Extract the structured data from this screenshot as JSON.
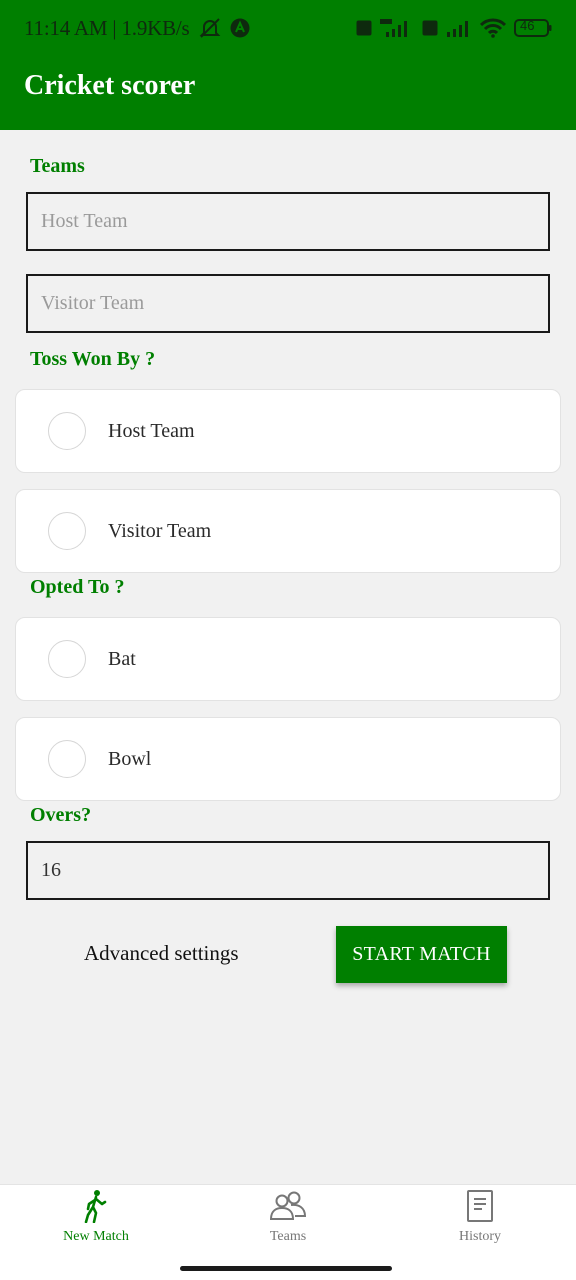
{
  "status_bar": {
    "time_speed": "11:14 AM | 1.9KB/s",
    "battery": "46"
  },
  "app_bar": {
    "title": "Cricket scorer"
  },
  "teams_section": {
    "label": "Teams",
    "host_placeholder": "Host Team",
    "visitor_placeholder": "Visitor Team"
  },
  "toss_section": {
    "label": "Toss Won By ?",
    "options": [
      "Host Team",
      "Visitor Team"
    ]
  },
  "opted_section": {
    "label": "Opted To ?",
    "options": [
      "Bat",
      "Bowl"
    ]
  },
  "overs_section": {
    "label": "Overs?",
    "value": "16"
  },
  "actions": {
    "advanced_label": "Advanced settings",
    "start_label": "START MATCH"
  },
  "bottom_nav": {
    "items": [
      {
        "label": "New Match",
        "icon": "walking-person-icon",
        "active": true
      },
      {
        "label": "Teams",
        "icon": "people-icon",
        "active": false
      },
      {
        "label": "History",
        "icon": "document-icon",
        "active": false
      }
    ]
  },
  "colors": {
    "primary": "#007f00",
    "background": "#f1f1f1"
  }
}
